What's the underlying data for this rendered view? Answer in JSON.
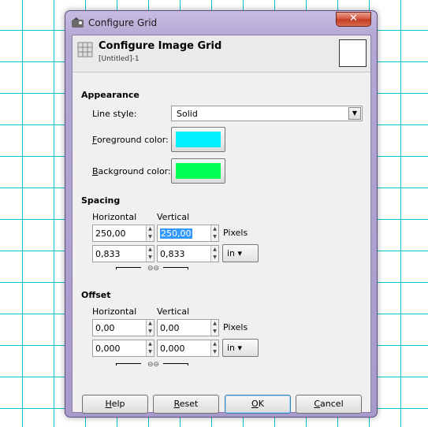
{
  "window": {
    "title": "Configure Grid",
    "close_label": "✕"
  },
  "header": {
    "title": "Configure Image Grid",
    "subtitle": "[Untitled]-1"
  },
  "appearance": {
    "title": "Appearance",
    "line_style_label": "Line style:",
    "line_style_value": "Solid",
    "fg_label_mn": "F",
    "fg_label_rest": "oreground color:",
    "fg_color": "#00f0ff",
    "bg_label_mn": "B",
    "bg_label_rest": "ackground color:",
    "bg_color": "#00ff55"
  },
  "spacing": {
    "title": "Spacing",
    "h_label": "Horizontal",
    "v_label": "Vertical",
    "h_pixels": "250,00",
    "v_pixels": "250,00",
    "pixels_label": "Pixels",
    "h_inches": "0,833",
    "v_inches": "0,833",
    "unit": "in"
  },
  "offset": {
    "title": "Offset",
    "h_label": "Horizontal",
    "v_label": "Vertical",
    "h_pixels": "0,00",
    "v_pixels": "0,00",
    "pixels_label": "Pixels",
    "h_inches": "0,000",
    "v_inches": "0,000",
    "unit": "in"
  },
  "buttons": {
    "help_mn": "H",
    "help_rest": "elp",
    "reset_mn": "R",
    "reset_rest": "eset",
    "ok_mn": "O",
    "ok_rest": "K",
    "cancel_mn": "C",
    "cancel_rest": "ancel"
  },
  "colors": {
    "grid_line": "#00c4d8",
    "title_bar": "#b3a7d4"
  }
}
